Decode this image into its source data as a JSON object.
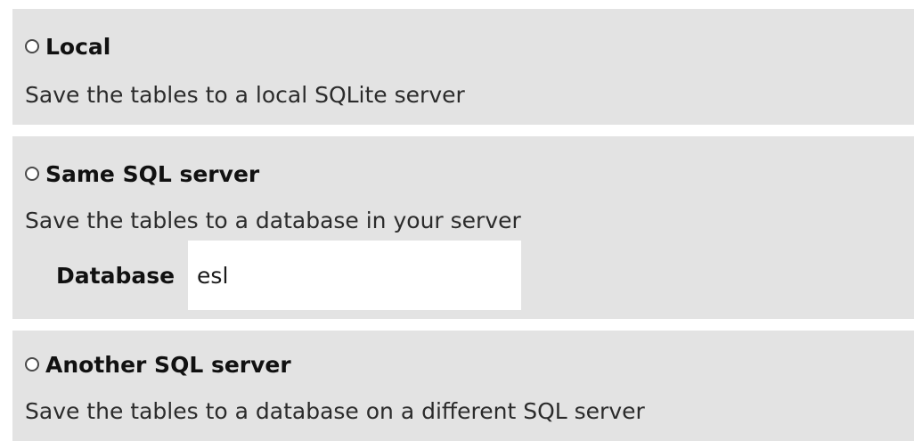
{
  "options": [
    {
      "label": "Local",
      "description": "Save the tables to a local SQLite server"
    },
    {
      "label": "Same SQL server",
      "description": "Save the tables to a database in your server",
      "field": {
        "label": "Database",
        "value": "esl"
      }
    },
    {
      "label": "Another SQL server",
      "description": "Save the tables to a database on a different SQL server"
    }
  ]
}
